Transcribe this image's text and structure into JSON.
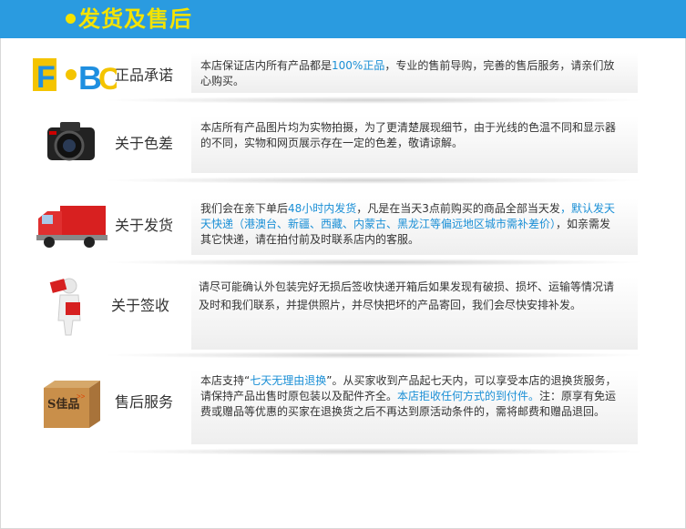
{
  "header": {
    "title": "发货及售后"
  },
  "rows": [
    {
      "label": "正品承诺",
      "icon": "fbc-logo-icon",
      "parts": [
        {
          "t": "本店保证店内所有产品都是"
        },
        {
          "t": "100%正品",
          "hl": true
        },
        {
          "t": "，专业的售前导购，完善的售后服务，请亲们放心购买。"
        }
      ]
    },
    {
      "label": "关于色差",
      "icon": "camera-icon",
      "parts": [
        {
          "t": "本店所有产品图片均为实物拍摄，为了更清楚展现细节，由于光线的色温不同和显示器的不同，实物和网页展示存在一定的色差，敬请谅解。"
        }
      ]
    },
    {
      "label": "关于发货",
      "icon": "truck-icon",
      "parts": [
        {
          "t": "我们会在亲下单后"
        },
        {
          "t": "48小时内发货",
          "hl": true
        },
        {
          "t": "，凡是在当天3点前购买的商品全部当天发"
        },
        {
          "t": "，默认发天天快递（港澳台、新疆、西藏、内蒙古、黑龙江等偏远地区城市需补差价）",
          "hl": true
        },
        {
          "t": "，如亲需发其它快递，请在拍付前及时联系店内的客服。"
        }
      ]
    },
    {
      "label": "关于签收",
      "icon": "person-parcel-icon",
      "parts": [
        {
          "t": "请尽可能确认外包装完好无损后签收快递开箱后如果发现有破损、损坏、运输等情况请及时和我们联系，并提供照片，并尽快把坏的产品寄回，我们会尽快安排补发。"
        }
      ]
    },
    {
      "label": "售后服务",
      "icon": "box-icon",
      "parts": [
        {
          "t": "本店支持“"
        },
        {
          "t": "七天无理由退换",
          "hl": true
        },
        {
          "t": "”。从买家收到产品起七天内，可以享受本店的退换货服务，请保持产品出售时原包装以及配件齐全。"
        },
        {
          "t": "本店拒收任何方式的到付件。",
          "hl": true
        },
        {
          "t": "注：原享有免运费或赠品等优惠的买家在退换货之后不再达到原活动条件的，需将邮费和赠品退回。"
        }
      ]
    }
  ]
}
